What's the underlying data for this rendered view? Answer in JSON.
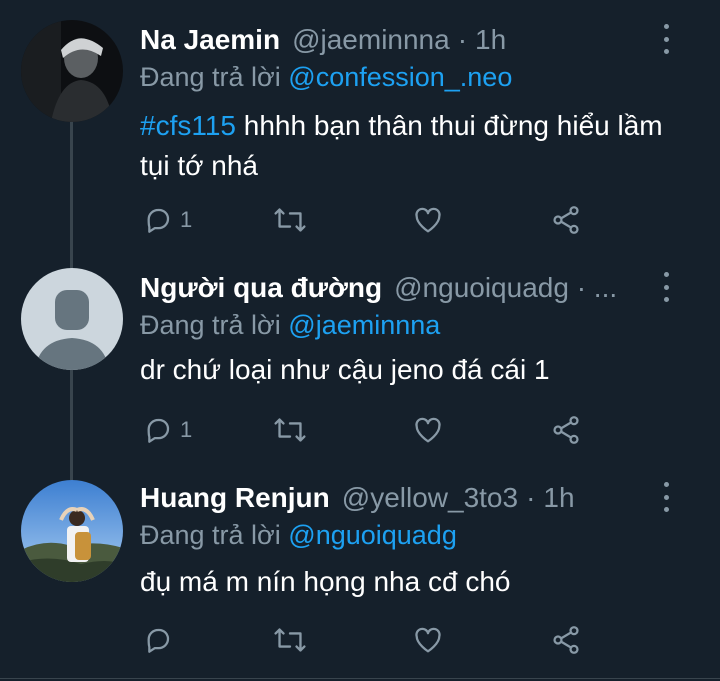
{
  "tweets": [
    {
      "name": "Na Jaemin",
      "handle": "@jaeminnna",
      "time": "1h",
      "reply_prefix": "Đang trả lời",
      "reply_to": "@confession_.neo",
      "hashtag": "#cfs115",
      "text": "hhhh bạn thân thui đừng hiểu lầm tụi tớ nhá",
      "reply_count": "1",
      "avatar": "photo-dark-portrait"
    },
    {
      "name": "Người qua đường",
      "handle": "@nguoiquadg · ...",
      "time": "",
      "reply_prefix": "Đang trả lời",
      "reply_to": "@jaeminnna",
      "hashtag": "",
      "text": "dr chứ loại như cậu jeno đá cái 1",
      "reply_count": "1",
      "avatar": "default-avatar"
    },
    {
      "name": "Huang Renjun",
      "handle": "@yellow_3to3",
      "time": "1h",
      "reply_prefix": "Đang trả lời",
      "reply_to": "@nguoiquadg",
      "hashtag": "",
      "text": "đụ má m nín họng nha cđ chó",
      "reply_count": "",
      "avatar": "photo-sky-backpack"
    }
  ],
  "icons": [
    "reply-icon",
    "retweet-icon",
    "like-icon",
    "share-icon",
    "more-icon"
  ],
  "colors": {
    "background": "#15202b",
    "muted": "#8899a6",
    "accent": "#1da1f2",
    "line": "#38444d"
  }
}
